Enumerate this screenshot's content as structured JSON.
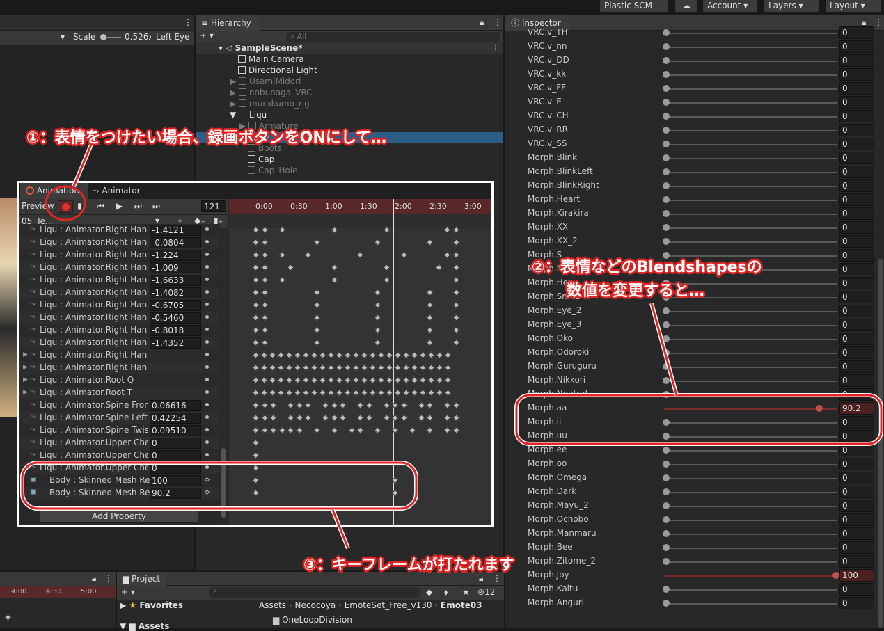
{
  "topbar": {
    "plastic_scm": "Plastic SCM",
    "account": "Account",
    "layers": "Layers",
    "layout": "Layout"
  },
  "scene_view": {
    "scale_label": "Scale",
    "scale_value": "0.526x",
    "eye": "Left Eye"
  },
  "hierarchy": {
    "tab": "Hierarchy",
    "search_placeholder": "All",
    "scene": "SampleScene*",
    "items": [
      "Main Camera",
      "Directional Light",
      "UsamiMidori",
      "nobunaga_VRC",
      "murakumo_rig",
      "Liqu",
      "Armature",
      "Body",
      "Boots",
      "Cap",
      "Cap_Hole"
    ]
  },
  "animation": {
    "tab_animation": "Animation",
    "tab_animator": "Animator",
    "preview": "Preview",
    "frame": "121",
    "clip": "05_Te...",
    "add_property": "Add Property",
    "timeline_ticks": [
      "0:00",
      "0:30",
      "1:00",
      "1:30",
      "2:00",
      "2:30",
      "3:00"
    ],
    "rows": [
      {
        "label": "Liqu : Animator.Right Hand.I",
        "value": "-1.4121"
      },
      {
        "label": "Liqu : Animator.Right Hand.I",
        "value": "-0.0804"
      },
      {
        "label": "Liqu : Animator.Right Hand.I",
        "value": "-1.224"
      },
      {
        "label": "Liqu : Animator.Right Hand.I",
        "value": "-1.009"
      },
      {
        "label": "Liqu : Animator.Right Hand.I",
        "value": "-1.6633"
      },
      {
        "label": "Liqu : Animator.Right Hand.I",
        "value": "-1.4082"
      },
      {
        "label": "Liqu : Animator.Right Hand.T",
        "value": "-0.6705"
      },
      {
        "label": "Liqu : Animator.Right Hand.T",
        "value": "-0.5460"
      },
      {
        "label": "Liqu : Animator.Right Hand.T",
        "value": "-0.8018"
      },
      {
        "label": "Liqu : Animator.Right Hand.T",
        "value": "-1.4352"
      },
      {
        "label": "Liqu : Animator.Right Hand Q",
        "value": ""
      },
      {
        "label": "Liqu : Animator.Right Hand T",
        "value": ""
      },
      {
        "label": "Liqu : Animator.Root Q",
        "value": ""
      },
      {
        "label": "Liqu : Animator.Root T",
        "value": ""
      },
      {
        "label": "Liqu : Animator.Spine Front-",
        "value": "0.06616"
      },
      {
        "label": "Liqu : Animator.Spine Left-R",
        "value": "0.42254"
      },
      {
        "label": "Liqu : Animator.Spine Twist",
        "value": "0.09510"
      },
      {
        "label": "Liqu : Animator.Upper Chest",
        "value": "0"
      },
      {
        "label": "Liqu : Animator.Upper Chest",
        "value": "0"
      },
      {
        "label": "Liqu : Animator.Upper Chest",
        "value": "0"
      },
      {
        "label": "Body : Skinned Mesh Ren",
        "value": "100"
      },
      {
        "label": "Body : Skinned Mesh Ren",
        "value": "90.2"
      }
    ]
  },
  "inspector": {
    "tab": "Inspector",
    "rows": [
      {
        "label": "VRC.v_TH",
        "value": "0"
      },
      {
        "label": "VRC.v_nn",
        "value": "0"
      },
      {
        "label": "VRC.v_DD",
        "value": "0"
      },
      {
        "label": "VRC.v_kk",
        "value": "0"
      },
      {
        "label": "VRC.v_FF",
        "value": "0"
      },
      {
        "label": "VRC.v_E",
        "value": "0"
      },
      {
        "label": "VRC.v_CH",
        "value": "0"
      },
      {
        "label": "VRC.v_RR",
        "value": "0"
      },
      {
        "label": "VRC.v_SS",
        "value": "0"
      },
      {
        "label": "Morph.Blink",
        "value": "0"
      },
      {
        "label": "Morph.BlinkLeft",
        "value": "0"
      },
      {
        "label": "Morph.BlinkRight",
        "value": "0"
      },
      {
        "label": "Morph.Heart",
        "value": "0"
      },
      {
        "label": "Morph.Kirakira",
        "value": "0"
      },
      {
        "label": "Morph.XX",
        "value": "0"
      },
      {
        "label": "Morph.XX_2",
        "value": "0"
      },
      {
        "label": "Morph.S",
        "value": "0"
      },
      {
        "label": "Morph.Ma",
        "value": "0"
      },
      {
        "label": "Morph.Hen",
        "value": "0"
      },
      {
        "label": "Morph.Smile",
        "value": "0"
      },
      {
        "label": "Morph.Eye_2",
        "value": "0"
      },
      {
        "label": "Morph.Eye_3",
        "value": "0"
      },
      {
        "label": "Morph.Oko",
        "value": "0"
      },
      {
        "label": "Morph.Odoroki",
        "value": "0"
      },
      {
        "label": "Morph.Guruguru",
        "value": "0"
      },
      {
        "label": "Morph.Nikkori",
        "value": "0"
      },
      {
        "label": "Morph.Neutral",
        "value": "0"
      },
      {
        "label": "Morph.aa",
        "value": "90.2",
        "recorded": true,
        "level": 0.902
      },
      {
        "label": "Morph.ii",
        "value": "0"
      },
      {
        "label": "Morph.uu",
        "value": "0"
      },
      {
        "label": "Morph.ee",
        "value": "0"
      },
      {
        "label": "Morph.oo",
        "value": "0"
      },
      {
        "label": "Morph.Omega",
        "value": "0"
      },
      {
        "label": "Morph.Dark",
        "value": "0"
      },
      {
        "label": "Morph.Mayu_2",
        "value": "0"
      },
      {
        "label": "Morph.Ochobo",
        "value": "0"
      },
      {
        "label": "Morph.Manmaru",
        "value": "0"
      },
      {
        "label": "Morph.Bee",
        "value": "0"
      },
      {
        "label": "Morph.Zitome_2",
        "value": "0"
      },
      {
        "label": "Morph.Joy",
        "value": "100",
        "recorded": true,
        "level": 1.0
      },
      {
        "label": "Morph.Kaltu",
        "value": "0"
      },
      {
        "label": "Morph.Anguri",
        "value": "0"
      }
    ]
  },
  "bottom_left": {
    "ticks": [
      "4:00",
      "4:30",
      "5:00"
    ]
  },
  "project": {
    "tab": "Project",
    "count": "12",
    "favorites": "Favorites",
    "assets": "Assets",
    "breadcrumb": [
      "Assets",
      "Necocoya",
      "EmoteSet_Free_v130",
      "Emote03"
    ],
    "folder": "OneLoopDivision"
  },
  "callouts": {
    "step1": "①：表情をつけたい場合、録画ボタンをONにして…",
    "step2_line1": "②：表情などのBlendshapesの",
    "step2_line2": "数値を変更すると…",
    "step3": "③：キーフレームが打たれます"
  },
  "colors": {
    "accent_red": "#e02424",
    "record_red": "#c0392b",
    "panel_bg": "#282828"
  }
}
